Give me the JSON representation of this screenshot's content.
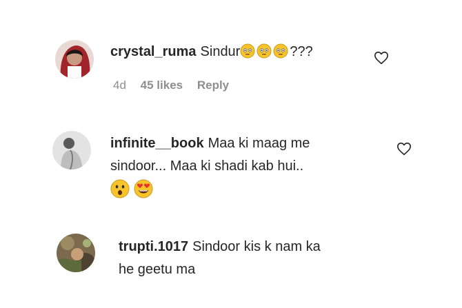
{
  "comments": [
    {
      "username": "crystal_ruma",
      "text_before": "Sindur",
      "emojis": [
        "flushed-face",
        "flushed-face",
        "flushed-face"
      ],
      "text_after": "???",
      "time": "4d",
      "likes": "45 likes",
      "reply_label": "Reply",
      "avatar_icon": "profile-photo-red"
    },
    {
      "username": "infinite__book",
      "line1": "Maa ki maag me",
      "line2": "sindoor... Maa ki shadi kab hui..",
      "emojis": [
        "astonished-face",
        "heart-eyes-face"
      ],
      "avatar_icon": "profile-photo-grey"
    },
    {
      "username": "trupti.1017",
      "line1": "Sindoor kis k nam ka",
      "line2": "he geetu ma",
      "avatar_icon": "profile-photo-brown"
    }
  ],
  "colors": {
    "text": "#262626",
    "secondary": "#8e8e8e",
    "emoji_yellow": "#f7c52b"
  }
}
